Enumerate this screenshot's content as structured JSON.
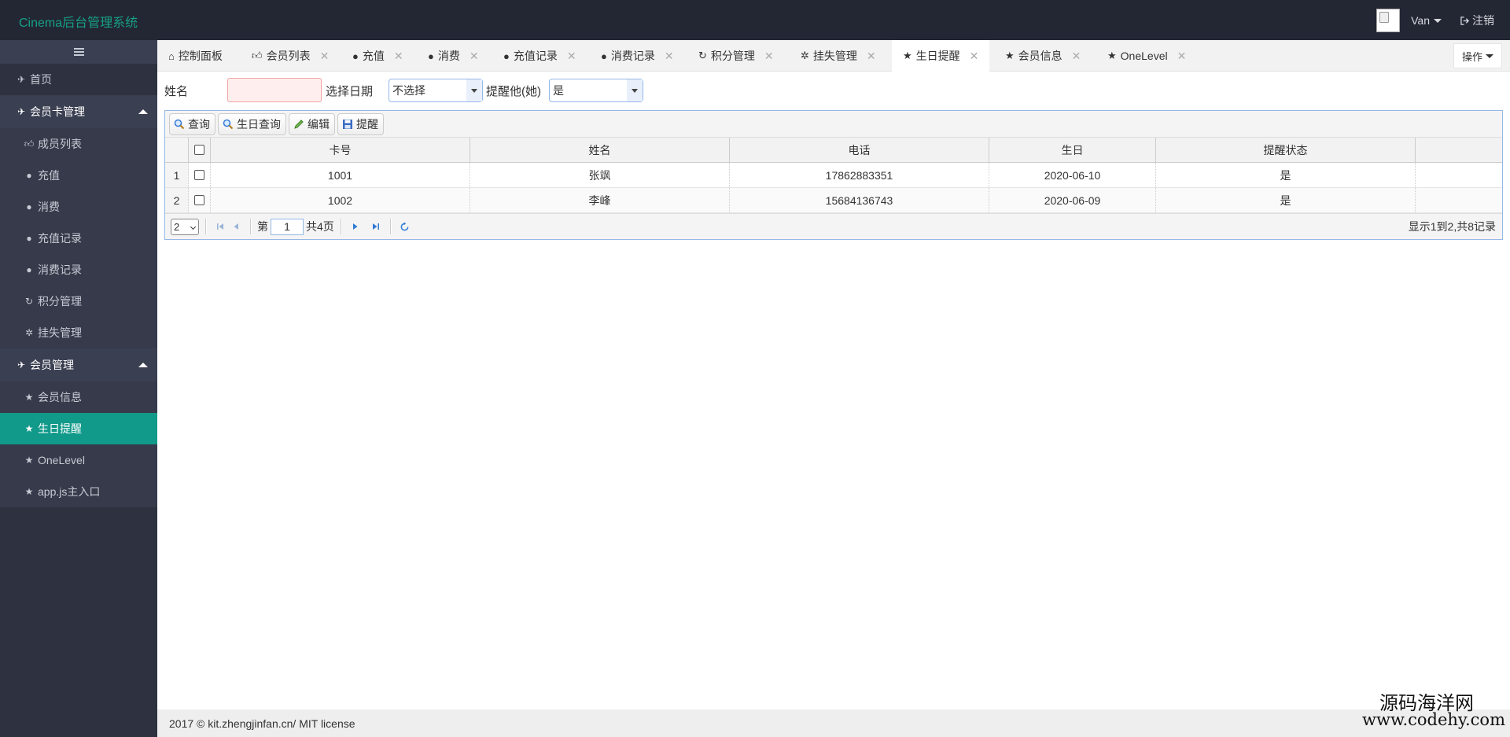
{
  "header": {
    "brand": "Cinema后台管理系统",
    "user": "Van",
    "logout": "注销"
  },
  "sidebar": {
    "home": "首页",
    "group1": {
      "label": "会员卡管理",
      "items": [
        "成员列表",
        "充值",
        "消费",
        "充值记录",
        "消费记录",
        "积分管理",
        "挂失管理"
      ]
    },
    "group2": {
      "label": "会员管理",
      "items": [
        "会员信息",
        "生日提醒",
        "OneLevel",
        "app.js主入口"
      ]
    }
  },
  "tabs": [
    {
      "label": "控制面板",
      "icon": "home-icon",
      "closable": false
    },
    {
      "label": "会员列表",
      "icon": "thumbs-up-icon",
      "closable": true
    },
    {
      "label": "充值",
      "icon": "user-icon",
      "closable": true
    },
    {
      "label": "消费",
      "icon": "user-icon",
      "closable": true
    },
    {
      "label": "充值记录",
      "icon": "user-icon",
      "closable": true
    },
    {
      "label": "消费记录",
      "icon": "user-icon",
      "closable": true
    },
    {
      "label": "积分管理",
      "icon": "refresh-icon",
      "closable": true
    },
    {
      "label": "挂失管理",
      "icon": "gear-icon",
      "closable": true
    },
    {
      "label": "生日提醒",
      "icon": "star-icon",
      "closable": true,
      "active": true
    },
    {
      "label": "会员信息",
      "icon": "star-icon",
      "closable": true
    },
    {
      "label": "OneLevel",
      "icon": "star-icon",
      "closable": true
    }
  ],
  "ops_label": "操作",
  "search": {
    "name_label": "姓名",
    "name_value": "",
    "date_label": "选择日期",
    "date_value": "不选择",
    "remind_label": "提醒他(她)",
    "remind_value": "是"
  },
  "toolbar": {
    "query": "查询",
    "birthday_query": "生日查询",
    "edit": "编辑",
    "remind": "提醒"
  },
  "table": {
    "columns": [
      "卡号",
      "姓名",
      "电话",
      "生日",
      "提醒状态"
    ],
    "rows": [
      {
        "num": "1",
        "card": "1001",
        "name": "张飒",
        "phone": "17862883351",
        "birthday": "2020-06-10",
        "status": "是"
      },
      {
        "num": "2",
        "card": "1002",
        "name": "李峰",
        "phone": "15684136743",
        "birthday": "2020-06-09",
        "status": "是"
      }
    ]
  },
  "pager": {
    "page_size": "2",
    "page_prefix": "第",
    "page_num": "1",
    "page_suffix": "共4页",
    "info": "显示1到2,共8记录"
  },
  "footer": "2017 © kit.zhengjinfan.cn/ MIT license",
  "watermark": {
    "line1": "源码海洋网",
    "line2": "www.codehy.com"
  }
}
